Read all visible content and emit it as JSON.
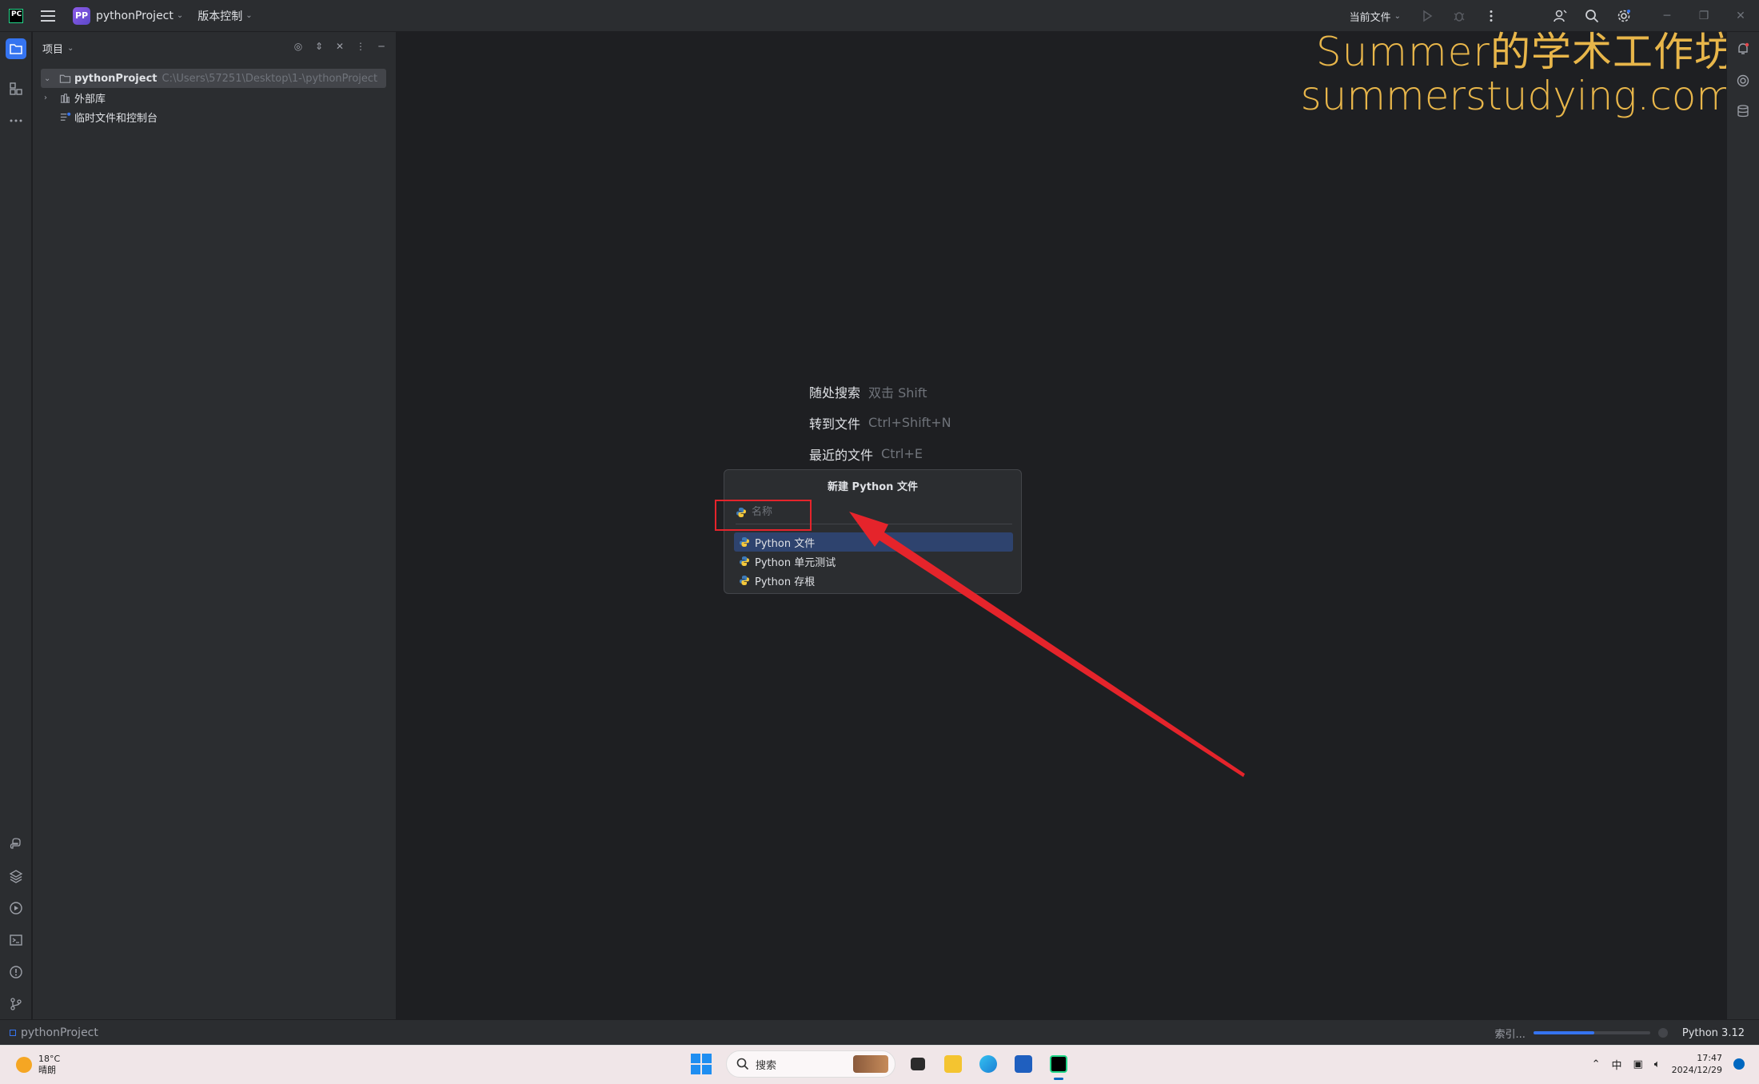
{
  "titlebar": {
    "project_badge": "PP",
    "project_name": "pythonProject",
    "vcs_label": "版本控制",
    "run_config": "当前文件"
  },
  "project_panel": {
    "title": "项目",
    "tree": [
      {
        "label": "pythonProject",
        "path": "C:\\Users\\57251\\Desktop\\1-\\pythonProject"
      },
      {
        "label": "外部库"
      },
      {
        "label": "临时文件和控制台"
      }
    ]
  },
  "watermark": {
    "line1": "Summer的学术工作坊",
    "line2": "summerstudying.com"
  },
  "hints": [
    {
      "label": "随处搜索",
      "shortcut": "双击 Shift"
    },
    {
      "label": "转到文件",
      "shortcut": "Ctrl+Shift+N"
    },
    {
      "label": "最近的文件",
      "shortcut": "Ctrl+E"
    }
  ],
  "popup": {
    "title": "新建 Python 文件",
    "input_placeholder": "名称",
    "items": [
      "Python 文件",
      "Python 单元测试",
      "Python 存根"
    ]
  },
  "statusbar": {
    "project": "pythonProject",
    "indexing": "索引...",
    "progress": 0.52,
    "interpreter": "Python 3.12"
  },
  "taskbar": {
    "temperature": "18°C",
    "weather": "晴朗",
    "search_placeholder": "搜索",
    "ime": "中",
    "time": "17:47",
    "date": "2024/12/29"
  },
  "colors": {
    "accent": "#3574f0",
    "annotation": "#e5242b",
    "watermark": "#e8b64a"
  }
}
